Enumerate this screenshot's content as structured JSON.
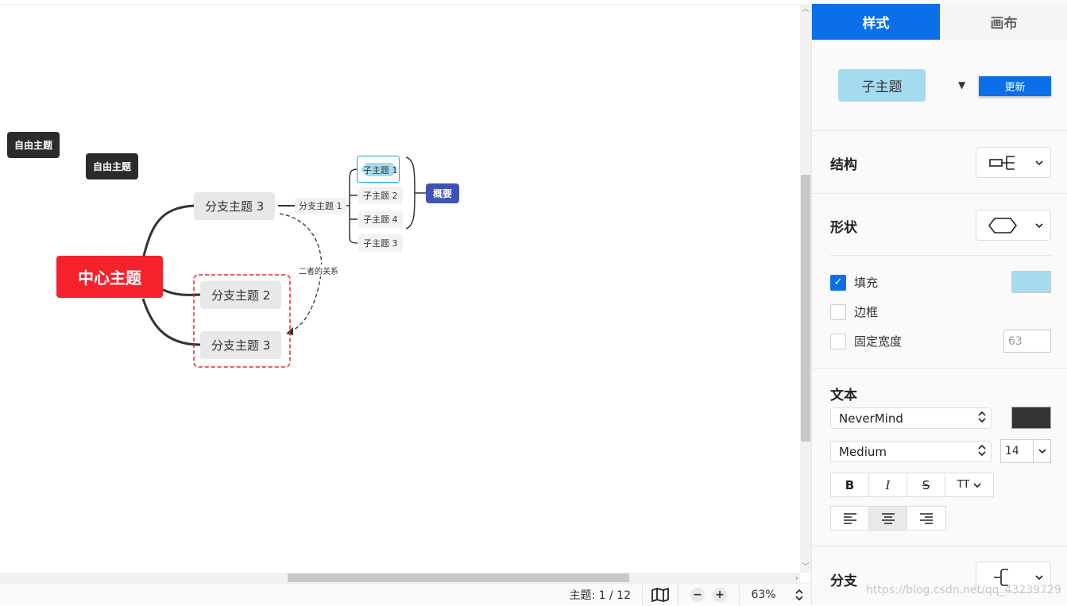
{
  "mindmap": {
    "free_topics": [
      "自由主题",
      "自由主题"
    ],
    "central": "中心主题",
    "branches": [
      "分支主题 3",
      "分支主题 2",
      "分支主题 3"
    ],
    "sub_branch": "分支主题 1",
    "children": [
      "子主题 1",
      "子主题 2",
      "子主题 4",
      "子主题 3"
    ],
    "summary": "概要",
    "relationship": "二者的关系",
    "colors": {
      "central": "#f5222d",
      "free_topic": "#2b2b2b",
      "summary": "#4052b5",
      "selection": "#1aa6e0",
      "boundary": "#e8232f"
    }
  },
  "statusbar": {
    "topic_label": "主题: 1 / 12",
    "zoom_out": "−",
    "zoom_in": "+",
    "zoom_value": "63%"
  },
  "panel": {
    "tabs": [
      {
        "label": "样式",
        "active": true
      },
      {
        "label": "画布",
        "active": false
      }
    ],
    "preview": {
      "topic_label": "子主题",
      "dropdown": "▼",
      "update_button": "更新"
    },
    "structure": {
      "title": "结构",
      "icon": "structure-icon"
    },
    "shape": {
      "title": "形状",
      "icon": "hexagon-shape-icon"
    },
    "fill": {
      "label": "填充",
      "checked": true,
      "color": "#a5dbee"
    },
    "border": {
      "label": "边框",
      "checked": false
    },
    "fixed_width": {
      "label": "固定宽度",
      "checked": false,
      "placeholder": "63"
    },
    "text": {
      "title": "文本",
      "font_family": "NeverMind",
      "font_weight": "Medium",
      "font_size": "14",
      "color": "#333333",
      "style_buttons": [
        "B",
        "I",
        "S",
        "TT"
      ],
      "align_buttons": [
        "align-left",
        "align-center",
        "align-right"
      ]
    },
    "branch": {
      "title": "分支",
      "icon": "branch-line-icon"
    }
  },
  "watermark": "https://blog.csdn.net/qq_43239729"
}
